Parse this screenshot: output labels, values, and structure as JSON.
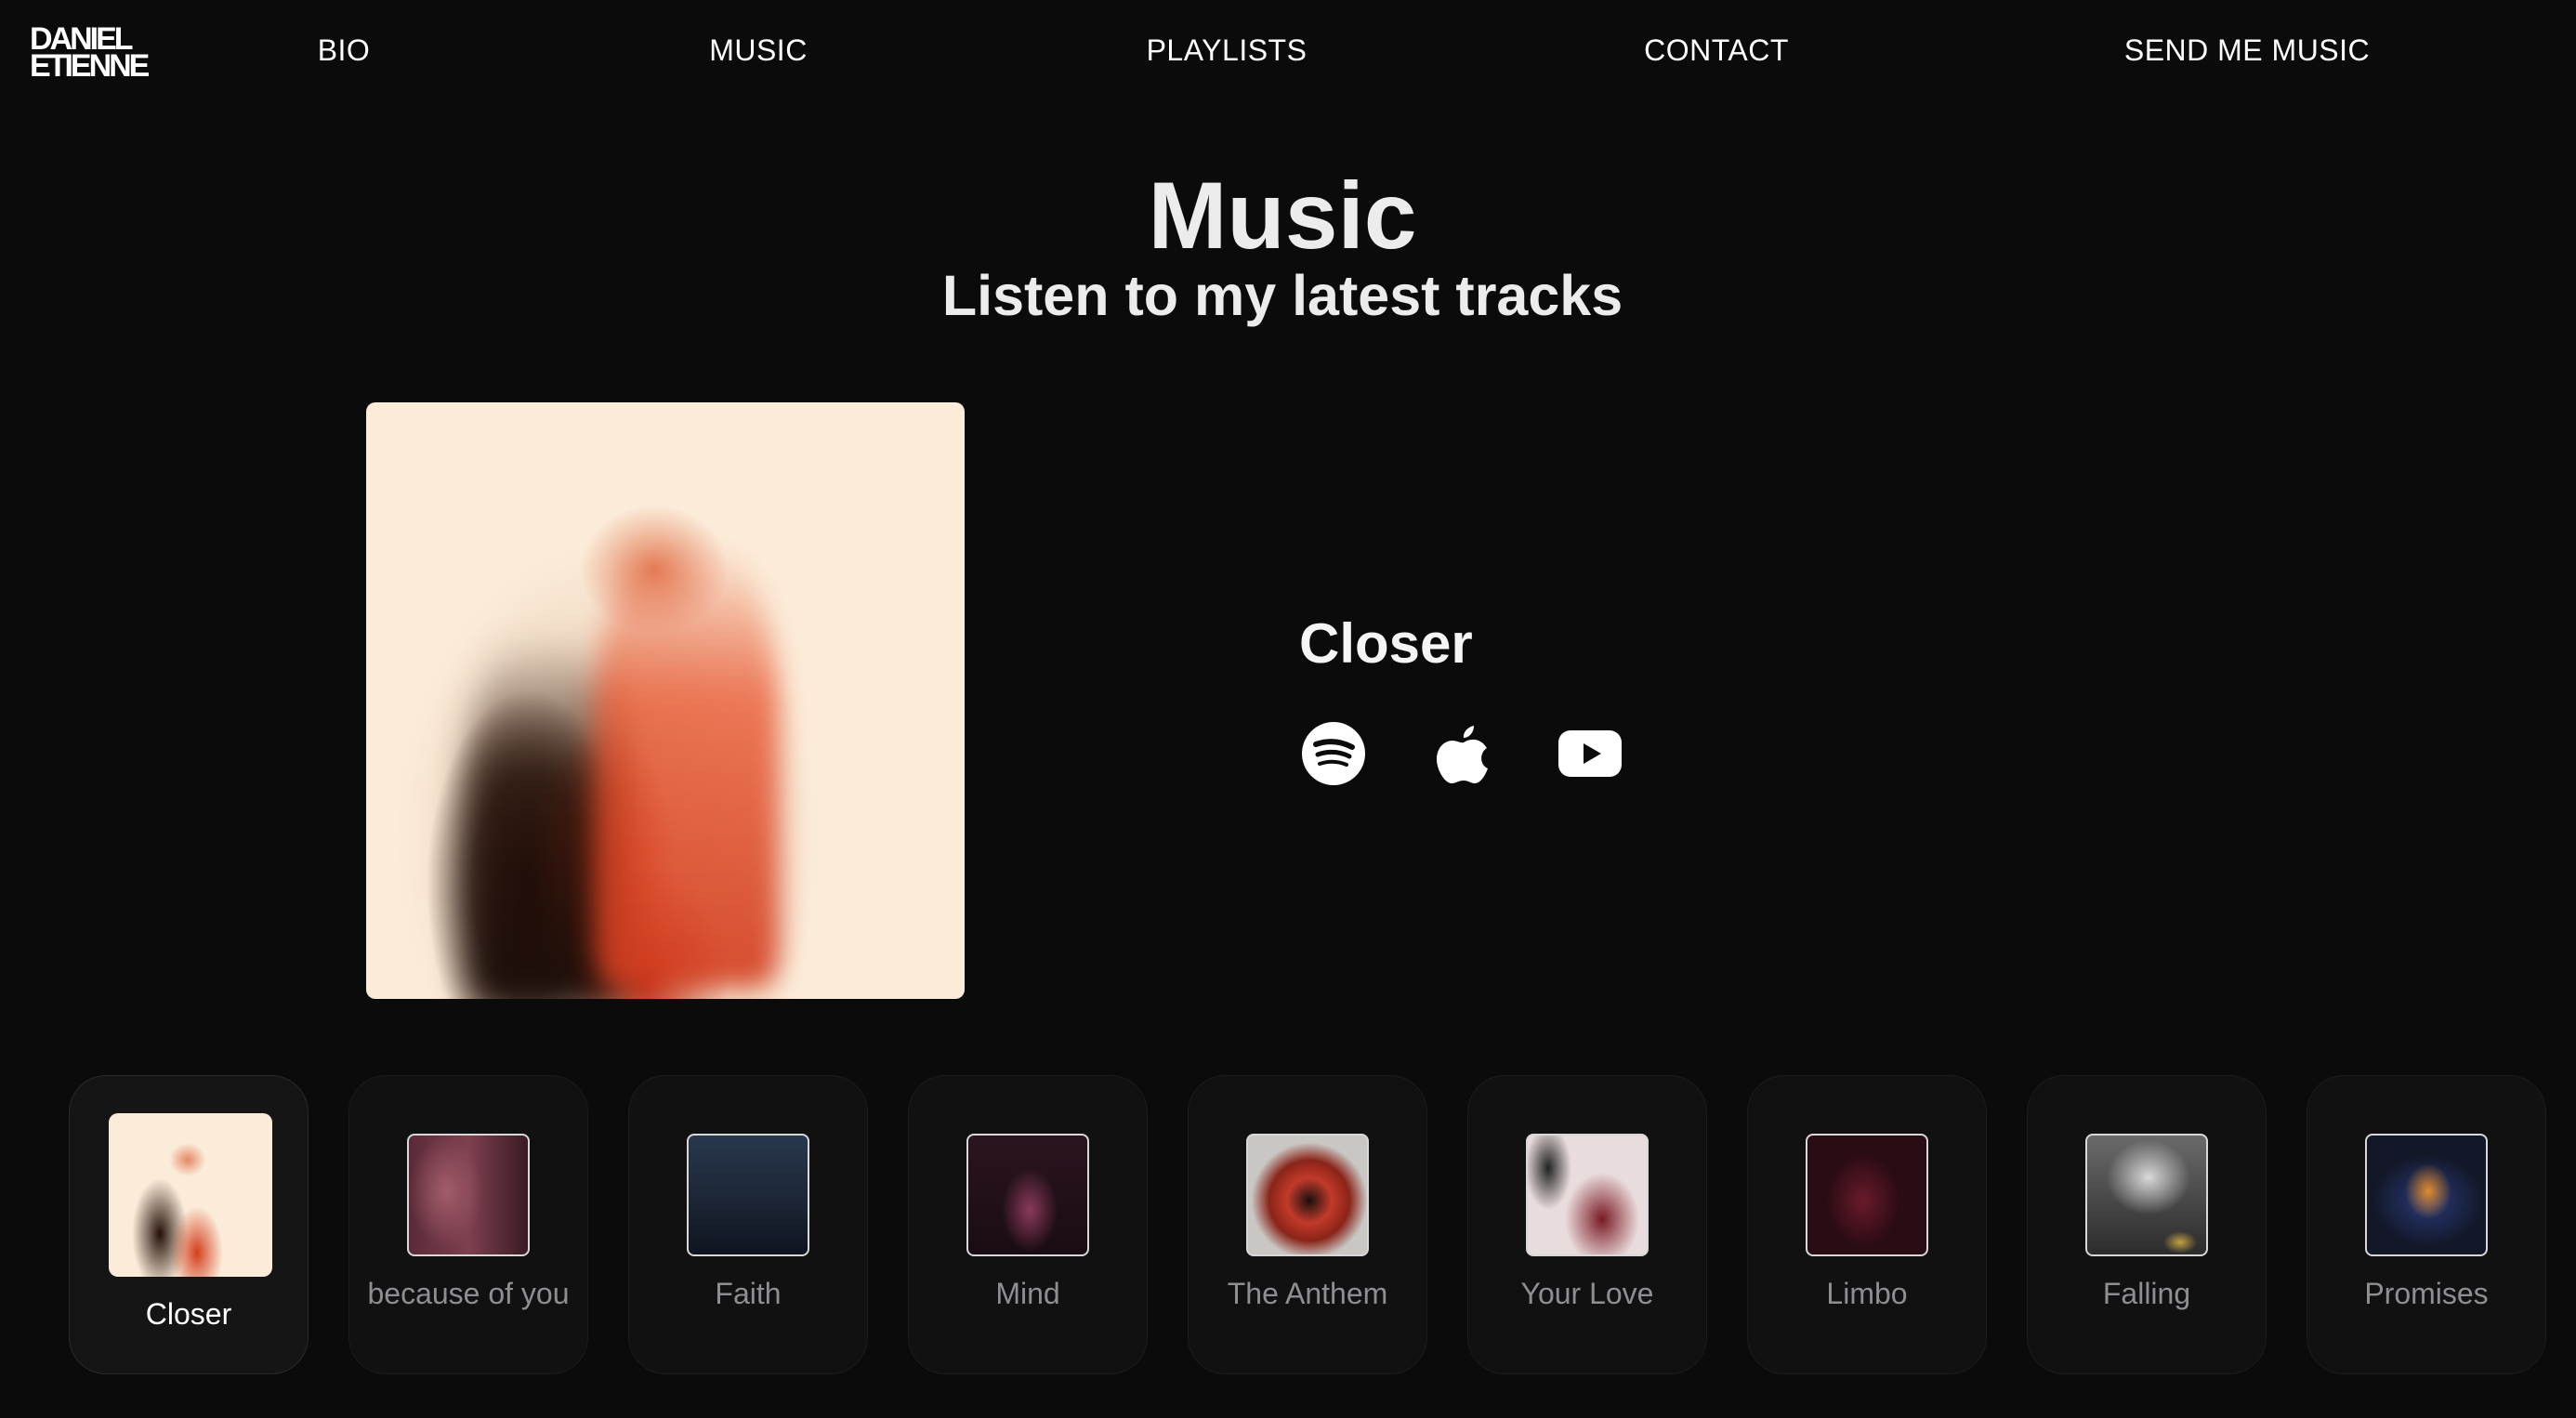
{
  "header": {
    "logo_line1": "DANIEL",
    "logo_line2": "ETIENNE",
    "nav": [
      "BIO",
      "MUSIC",
      "PLAYLISTS",
      "CONTACT",
      "SEND ME MUSIC"
    ]
  },
  "main": {
    "title": "Music",
    "subtitle": "Listen to my latest tracks"
  },
  "featured": {
    "title": "Closer",
    "platforms": [
      "spotify-icon",
      "apple-icon",
      "youtube-icon"
    ]
  },
  "tracks": [
    "Closer",
    "because of you",
    "Faith",
    "Mind",
    "The Anthem",
    "Your Love",
    "Limbo",
    "Falling",
    "Promises"
  ],
  "active_track": "Closer",
  "colors": {
    "background": "#0b0b0c",
    "card": "#111112",
    "text": "#f2f2f2",
    "muted": "#8e8e93",
    "accent": "#e0401e"
  }
}
